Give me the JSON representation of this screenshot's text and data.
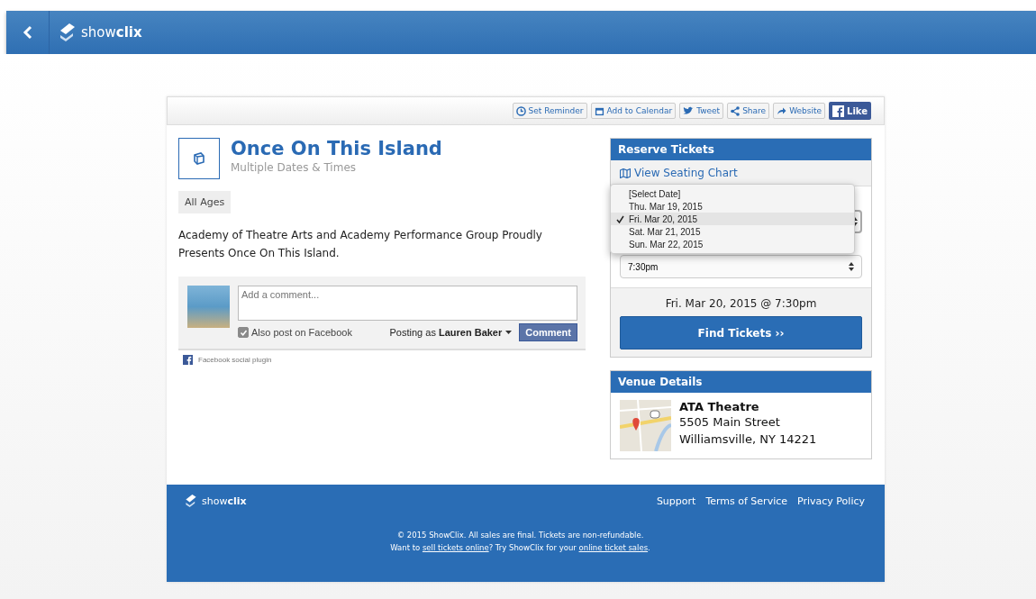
{
  "header": {
    "logo": "show**clix**"
  },
  "toolbar": [
    "Set Reminder",
    "Add to Calendar",
    "Tweet",
    "Share",
    "Website"
  ],
  "like_button": "Like",
  "event": {
    "title": "Once On This Island",
    "subtitle": "Multiple Dates & Times",
    "tag": "All Ages",
    "description": "Academy of Theatre Arts and Academy Performance Group Proudly Presents Once On This Island."
  },
  "comments": {
    "placeholder": "Add a comment...",
    "also_post": {
      "label": "Also post on Facebook",
      "checked": true
    },
    "posting_as": "Posting as **Lauren Baker**",
    "button": "Comment",
    "plugin": "Facebook social plugin"
  },
  "reserve": {
    "title": "Reserve Tickets",
    "seating_link": "View Seating Chart",
    "date_options": [
      {
        "label": "[Select Date]",
        "selected": false
      },
      {
        "label": "Thu. Mar 19, 2015",
        "selected": false
      },
      {
        "label": "Fri. Mar 20, 2015",
        "selected": true
      },
      {
        "label": "Sat. Mar 21, 2015",
        "selected": false
      },
      {
        "label": "Sun. Mar 22, 2015",
        "selected": false
      }
    ],
    "time_select": "7:30pm",
    "summary": "Fri. Mar 20, 2015 @ 7:30pm",
    "button": "Find Tickets ››"
  },
  "venue": {
    "title": "Venue Details",
    "name": "ATA Theatre",
    "street": "5505 Main Street",
    "city": "Williamsville, NY 14221"
  },
  "footer": {
    "logo": "show**clix**",
    "links": [
      "Support",
      "Terms of Service",
      "Privacy Policy"
    ],
    "copyright": "© 2015 ShowClix. All sales are final. Tickets are non-refundable.",
    "promo": {
      "before": "Want to ",
      "link1": "sell tickets online",
      "middle": "? Try ShowClix for your ",
      "link2": "online ticket sales",
      "after": "."
    }
  }
}
